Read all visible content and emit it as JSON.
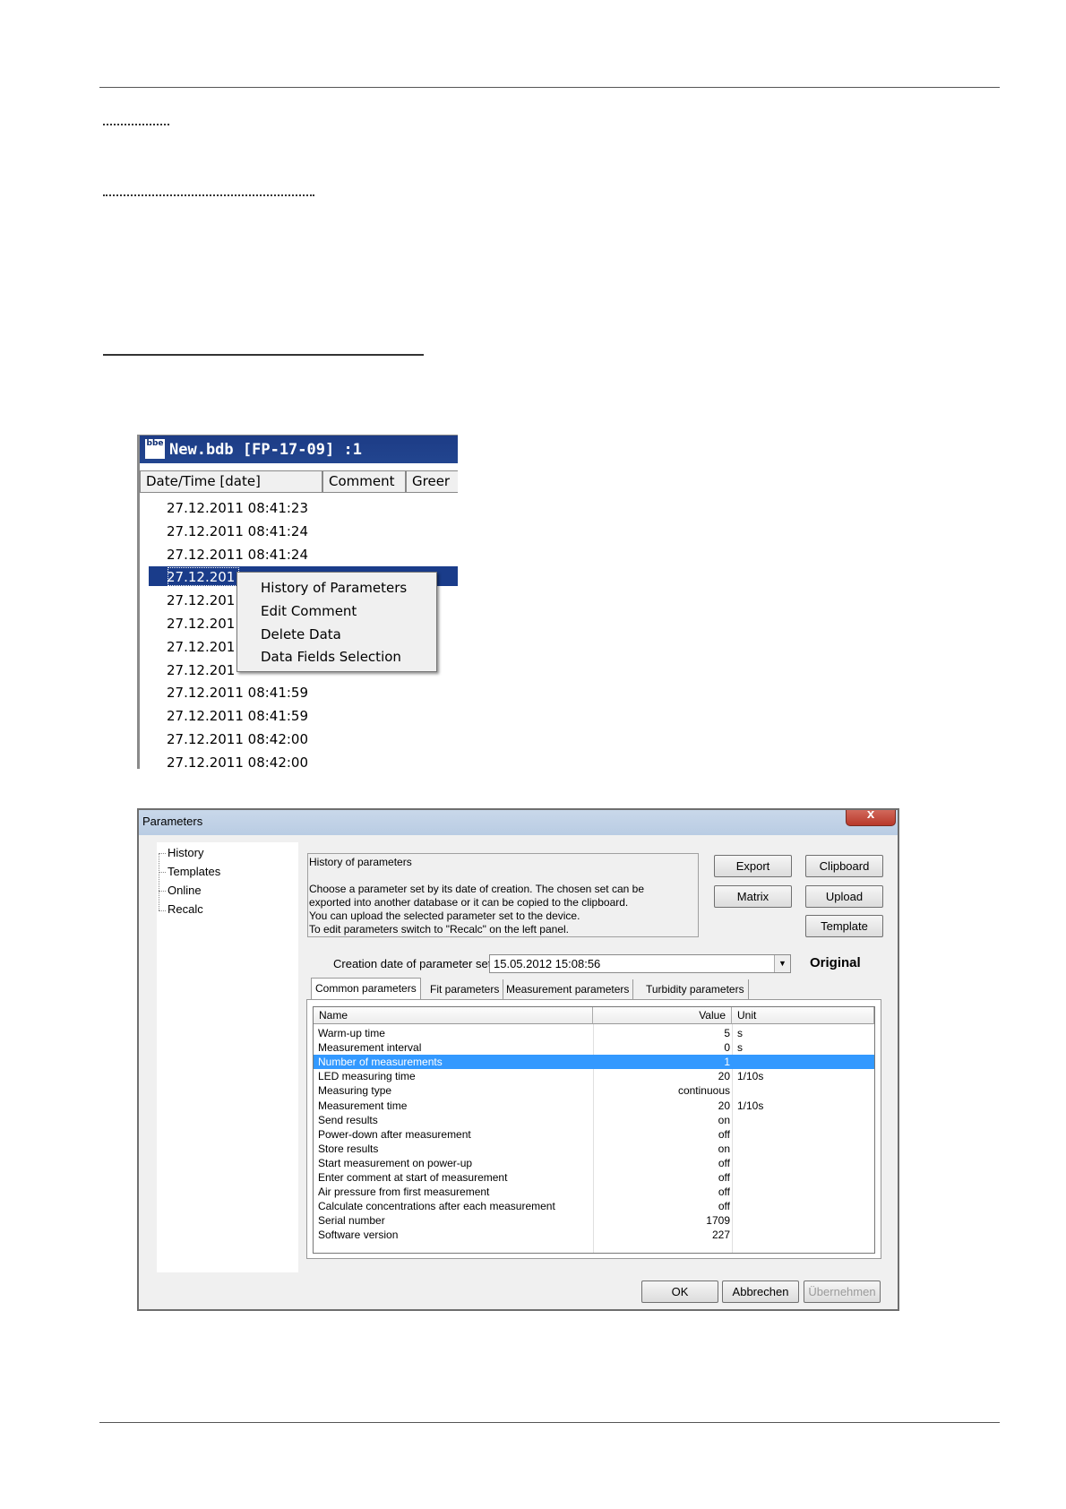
{
  "window1": {
    "title": "New.bdb [FP-17-09] :1",
    "logo_text": "bbe",
    "columns": [
      "Date/Time [date]",
      "Comment",
      "Greer"
    ],
    "rows": [
      "27.12.2011 08:41:23",
      "27.12.2011 08:41:24",
      "27.12.2011 08:41:24",
      "27.12.201",
      "27.12.201",
      "27.12.201",
      "27.12.201",
      "27.12.201",
      "27.12.2011 08:41:59",
      "27.12.2011 08:41:59",
      "27.12.2011 08:42:00",
      "27.12.2011 08:42:00"
    ],
    "selected_row_index": 3,
    "context_menu": [
      "History of Parameters",
      "Edit Comment",
      "Delete Data",
      "Data Fields Selection"
    ]
  },
  "window2": {
    "title": "Parameters",
    "close_label": "x",
    "tree": [
      "History",
      "Templates",
      "Online",
      "Recalc"
    ],
    "info": {
      "heading": "History of parameters",
      "lines": [
        "Choose a parameter set by its date of creation. The chosen set can be",
        "exported into another database or it can be copied to the clipboard.",
        "You can upload the selected parameter set to the device.",
        "To edit parameters switch to \"Recalc\" on the left panel."
      ]
    },
    "buttons": {
      "export": "Export",
      "clipboard": "Clipboard",
      "matrix": "Matrix",
      "upload": "Upload",
      "template": "Template"
    },
    "creation_label": "Creation date of parameter set",
    "creation_value": "15.05.2012 15:08:56",
    "original_label": "Original",
    "tabs": [
      "Common parameters",
      "Fit parameters",
      "Measurement parameters",
      "Turbidity parameters"
    ],
    "grid_headers": [
      "Name",
      "Value",
      "Unit"
    ],
    "grid_rows": [
      {
        "name": "Warm-up time",
        "value": "5",
        "unit": "s"
      },
      {
        "name": "Measurement interval",
        "value": "0",
        "unit": "s"
      },
      {
        "name": "Number of measurements",
        "value": "1",
        "unit": ""
      },
      {
        "name": "LED measuring time",
        "value": "20",
        "unit": "1/10s"
      },
      {
        "name": "Measuring type",
        "value": "continuous",
        "unit": ""
      },
      {
        "name": "Measurement time",
        "value": "20",
        "unit": "1/10s"
      },
      {
        "name": "Send results",
        "value": "on",
        "unit": ""
      },
      {
        "name": "Power-down after measurement",
        "value": "off",
        "unit": ""
      },
      {
        "name": "Store results",
        "value": "on",
        "unit": ""
      },
      {
        "name": "Start measurement on power-up",
        "value": "off",
        "unit": ""
      },
      {
        "name": "Enter comment at start of measurement",
        "value": "off",
        "unit": ""
      },
      {
        "name": "Air pressure from first measurement",
        "value": "off",
        "unit": ""
      },
      {
        "name": "Calculate concentrations after each measurement",
        "value": "off",
        "unit": ""
      },
      {
        "name": "Serial number",
        "value": "1709",
        "unit": ""
      },
      {
        "name": "Software version",
        "value": "227",
        "unit": ""
      }
    ],
    "selected_grid_row": 2,
    "footer": {
      "ok": "OK",
      "cancel": "Abbrechen",
      "apply": "Übernehmen"
    }
  }
}
